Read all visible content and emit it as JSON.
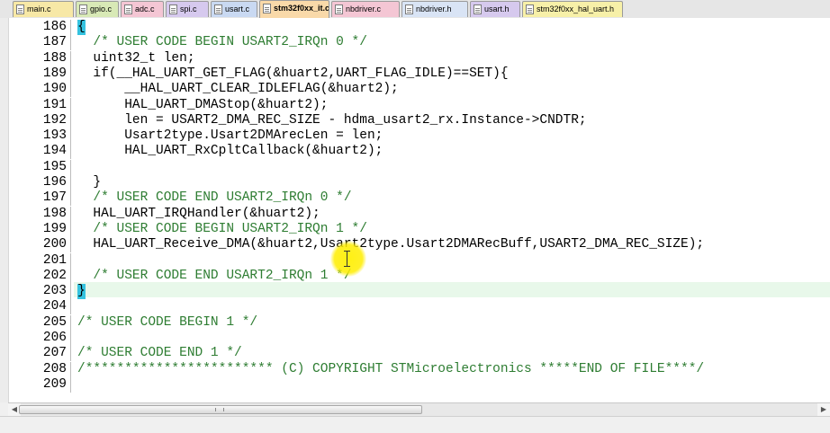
{
  "tabs": [
    {
      "label": "main.c",
      "color": "#f7e8a6",
      "active": false
    },
    {
      "label": "gpio.c",
      "color": "#d8e9b6",
      "active": false
    },
    {
      "label": "adc.c",
      "color": "#f4c6d4",
      "active": false
    },
    {
      "label": "spi.c",
      "color": "#d6c9ee",
      "active": false
    },
    {
      "label": "usart.c",
      "color": "#c9d9f2",
      "active": false
    },
    {
      "label": "stm32f0xx_it.c",
      "color": "#f9d9a9",
      "active": true
    },
    {
      "label": "nbdriver.c",
      "color": "#f4c6d4",
      "active": false
    },
    {
      "label": "nbdriver.h",
      "color": "#d9e4f5",
      "active": false
    },
    {
      "label": "usart.h",
      "color": "#d6c9ee",
      "active": false
    },
    {
      "label": "stm32f0xx_hal_uart.h",
      "color": "#f7f0a8",
      "active": false
    }
  ],
  "editor": {
    "lines": [
      {
        "num": "186",
        "text": "{",
        "style": "brace"
      },
      {
        "num": "187",
        "text": "  /* USER CODE BEGIN USART2_IRQn 0 */",
        "style": "cmt"
      },
      {
        "num": "188",
        "text": "  uint32_t len;",
        "style": "code"
      },
      {
        "num": "189",
        "text": "  if(__HAL_UART_GET_FLAG(&huart2,UART_FLAG_IDLE)==SET){",
        "style": "code"
      },
      {
        "num": "190",
        "text": "      __HAL_UART_CLEAR_IDLEFLAG(&huart2);",
        "style": "code"
      },
      {
        "num": "191",
        "text": "      HAL_UART_DMAStop(&huart2);",
        "style": "code"
      },
      {
        "num": "192",
        "text": "      len = USART2_DMA_REC_SIZE - hdma_usart2_rx.Instance->CNDTR;",
        "style": "code"
      },
      {
        "num": "193",
        "text": "      Usart2type.Usart2DMArecLen = len;",
        "style": "code"
      },
      {
        "num": "194",
        "text": "      HAL_UART_RxCpltCallback(&huart2);",
        "style": "code"
      },
      {
        "num": "195",
        "text": "",
        "style": "code"
      },
      {
        "num": "196",
        "text": "  }",
        "style": "code"
      },
      {
        "num": "197",
        "text": "  /* USER CODE END USART2_IRQn 0 */",
        "style": "cmt"
      },
      {
        "num": "198",
        "text": "  HAL_UART_IRQHandler(&huart2);",
        "style": "code"
      },
      {
        "num": "199",
        "text": "  /* USER CODE BEGIN USART2_IRQn 1 */",
        "style": "cmt"
      },
      {
        "num": "200",
        "text": "  HAL_UART_Receive_DMA(&huart2,Usart2type.Usart2DMARecBuff,USART2_DMA_REC_SIZE);",
        "style": "code"
      },
      {
        "num": "201",
        "text": "",
        "style": "code"
      },
      {
        "num": "202",
        "text": "  /* USER CODE END USART2_IRQn 1 */",
        "style": "cmt"
      },
      {
        "num": "203",
        "text": "}",
        "style": "brace"
      },
      {
        "num": "204",
        "text": "",
        "style": "code"
      },
      {
        "num": "205",
        "text": "/* USER CODE BEGIN 1 */",
        "style": "cmt"
      },
      {
        "num": "206",
        "text": "",
        "style": "code"
      },
      {
        "num": "207",
        "text": "/* USER CODE END 1 */",
        "style": "cmt"
      },
      {
        "num": "208",
        "text": "/************************ (C) COPYRIGHT STMicroelectronics *****END OF FILE****/",
        "style": "cmt"
      },
      {
        "num": "209",
        "text": "",
        "style": "code"
      }
    ],
    "current_line": "203",
    "highlight_color": "#35c3e0",
    "comment_color": "#2e7d32"
  },
  "scrollbar": {
    "left_arrow": "◀",
    "right_arrow": "▶"
  }
}
